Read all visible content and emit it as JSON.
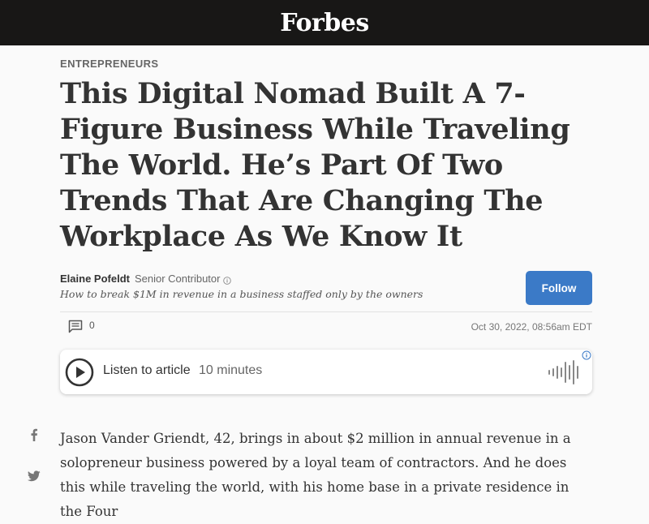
{
  "header": {
    "logo": "Forbes",
    "background": "#181716"
  },
  "article": {
    "channel": "ENTREPRENEURS",
    "headline": "This Digital Nomad Built A 7-Figure Business While Traveling The World. He’s Part Of Two Trends That Are Changing The Workplace As We Know It",
    "author": {
      "name": "Elaine Pofeldt",
      "role": "Senior Contributor",
      "bio": "How to break $1M in revenue in a business staffed only by the owners"
    },
    "follow_label": "Follow",
    "comment_count": "0",
    "timestamp": "Oct 30, 2022, 08:56am EDT",
    "audio": {
      "label": "Listen to article",
      "duration": "10 minutes"
    },
    "body": "Jason Vander Griendt, 42, brings in about $2 million in annual revenue in a solopreneur business powered by a loyal team of contractors. And he does this while traveling the world, with his home base in a private residence in the Four"
  },
  "social": {
    "icons": [
      "facebook-icon",
      "twitter-icon"
    ]
  },
  "colors": {
    "accent": "#3b7ac7",
    "text": "#333333",
    "muted": "#666666"
  }
}
